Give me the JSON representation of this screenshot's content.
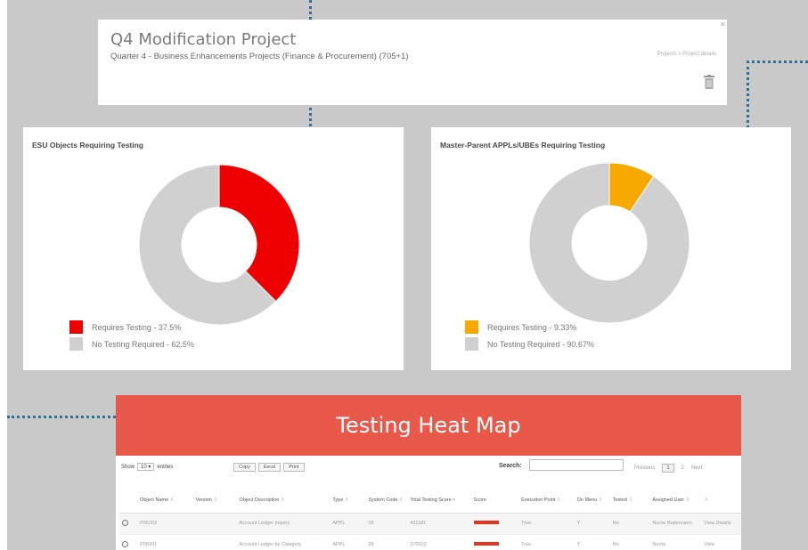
{
  "project": {
    "title": "Q4 Modification Project",
    "subtitle": "Quarter 4 - Business Enhancements Projects (Finance & Procurement) (705+1)",
    "breadcrumb": "Projects  >  Project details",
    "close_label": "×",
    "delete_icon": "trash-icon"
  },
  "charts": {
    "esu": {
      "title": "ESU Objects Requiring Testing",
      "legend": [
        {
          "label": "Requires Testing - 37.5%",
          "color": "#ee0000"
        },
        {
          "label": "No Testing Required - 62.5%",
          "color": "#d0d0d0"
        }
      ]
    },
    "master": {
      "title": "Master-Parent APPLs/UBEs Requiring Testing",
      "legend": [
        {
          "label": "Requires Testing - 9.33%",
          "color": "#f7a900"
        },
        {
          "label": "No Testing Required - 90.67%",
          "color": "#d0d0d0"
        }
      ]
    }
  },
  "chart_data": [
    {
      "type": "pie",
      "title": "ESU Objects Requiring Testing",
      "categories": [
        "Requires Testing",
        "No Testing Required"
      ],
      "values": [
        37.5,
        62.5
      ],
      "colors": [
        "#ee0000",
        "#d0d0d0"
      ],
      "legend": "bottom-left"
    },
    {
      "type": "pie",
      "title": "Master-Parent APPLs/UBEs Requiring Testing",
      "categories": [
        "Requires Testing",
        "No Testing Required"
      ],
      "values": [
        9.33,
        90.67
      ],
      "colors": [
        "#f7a900",
        "#d0d0d0"
      ],
      "legend": "bottom-left"
    }
  ],
  "heatmap": {
    "title": "Testing Heat Map",
    "show_label": "Show",
    "show_value": "10",
    "entries_label": "entries",
    "buttons": [
      "Copy",
      "Excel",
      "Print"
    ],
    "search_label": "Search:",
    "search_value": "",
    "pager": {
      "previous": "Previous",
      "current": "1",
      "next_page": "2",
      "next": "Next"
    },
    "columns": [
      "Object Name",
      "Version",
      "Object Description",
      "Type",
      "System Code",
      "Total Testing Score",
      "Score",
      "Execution Point",
      "On Menu",
      "Tested",
      "Assigned User",
      ""
    ],
    "rows": [
      {
        "name": "P05203",
        "version": "",
        "desc": "Account Ledger Inquiry",
        "type": "APPL",
        "code": "09",
        "total": "401181",
        "exec": "True",
        "menu": "Y",
        "tested": "No",
        "user": "Norrie Bodenosen",
        "action": "View Details"
      },
      {
        "name": "P09201",
        "version": "",
        "desc": "Account Ledger by Category",
        "type": "APPL",
        "code": "09",
        "total": "370022",
        "exec": "True",
        "menu": "Y",
        "tested": "No",
        "user": "Norrie",
        "action": "View"
      }
    ],
    "score_color": "#e8341f"
  }
}
